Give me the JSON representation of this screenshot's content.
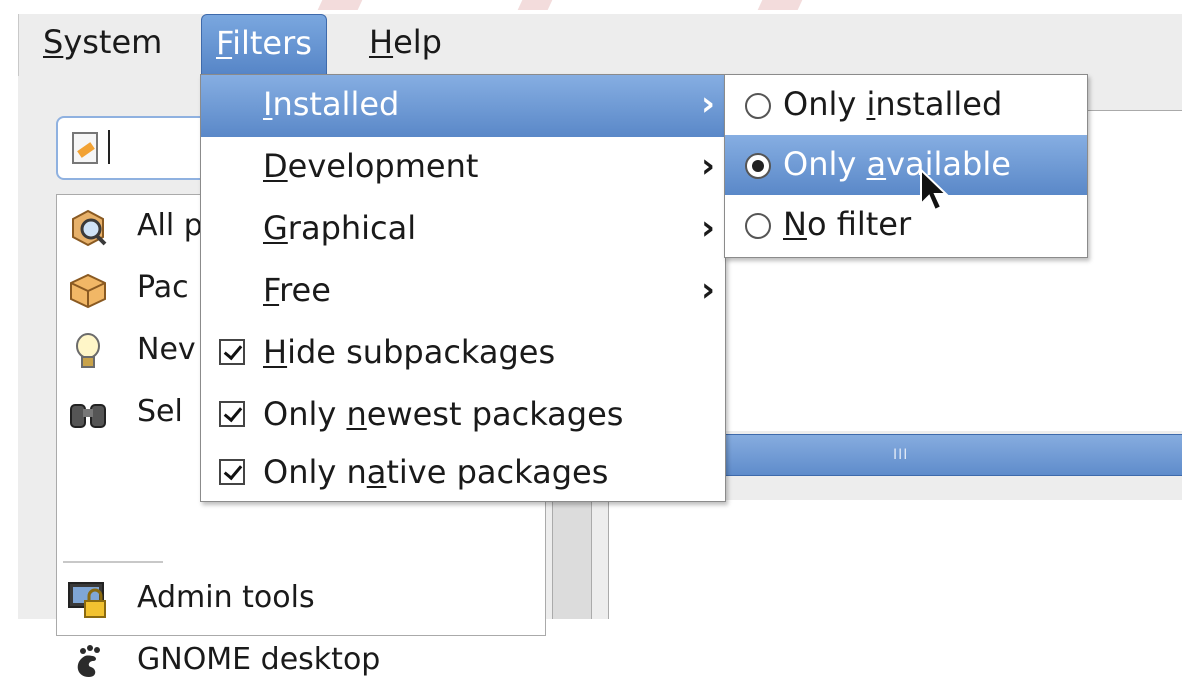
{
  "menubar": {
    "system": {
      "pre": "",
      "u": "S",
      "post": "ystem"
    },
    "filters": {
      "pre": "",
      "u": "F",
      "post": "ilters"
    },
    "help": {
      "pre": "",
      "u": "H",
      "post": "elp"
    }
  },
  "sidebar": {
    "items": [
      {
        "label": "All p",
        "icon": "package-search-icon"
      },
      {
        "label": "Pac",
        "icon": "package-box-icon"
      },
      {
        "label": "Nev",
        "icon": "lightbulb-icon"
      },
      {
        "label": "Sel",
        "icon": "binoculars-icon"
      },
      {
        "label": "Admin tools",
        "icon": "admin-lock-icon"
      },
      {
        "label": "GNOME desktop",
        "icon": "gnome-foot-icon"
      }
    ]
  },
  "filters_menu": {
    "installed": {
      "pre": "",
      "u": "I",
      "post": "nstalled"
    },
    "development": {
      "pre": "",
      "u": "D",
      "post": "evelopment"
    },
    "graphical": {
      "pre": "",
      "u": "G",
      "post": "raphical"
    },
    "free": {
      "pre": "",
      "u": "F",
      "post": "ree"
    },
    "hide_subpackages": {
      "pre": "",
      "u": "H",
      "post": "ide subpackages",
      "checked": true
    },
    "only_newest": {
      "pre": "Only ",
      "u": "n",
      "post": "ewest packages",
      "checked": true
    },
    "only_native": {
      "pre": "Only n",
      "u": "a",
      "post": "tive packages",
      "checked": true
    },
    "arrow": "›"
  },
  "installed_submenu": {
    "only_installed": {
      "pre": "Only ",
      "u": "i",
      "post": "nstalled",
      "selected": false
    },
    "only_available": {
      "pre": "Only ",
      "u": "a",
      "post": "vailable",
      "selected": true
    },
    "no_filter": {
      "pre": "",
      "u": "N",
      "post": "o filter",
      "selected": false
    }
  },
  "scrollbar": {
    "grip": "III"
  },
  "colors": {
    "highlight": "#5a88c8",
    "menubar_bg": "#ededed"
  }
}
